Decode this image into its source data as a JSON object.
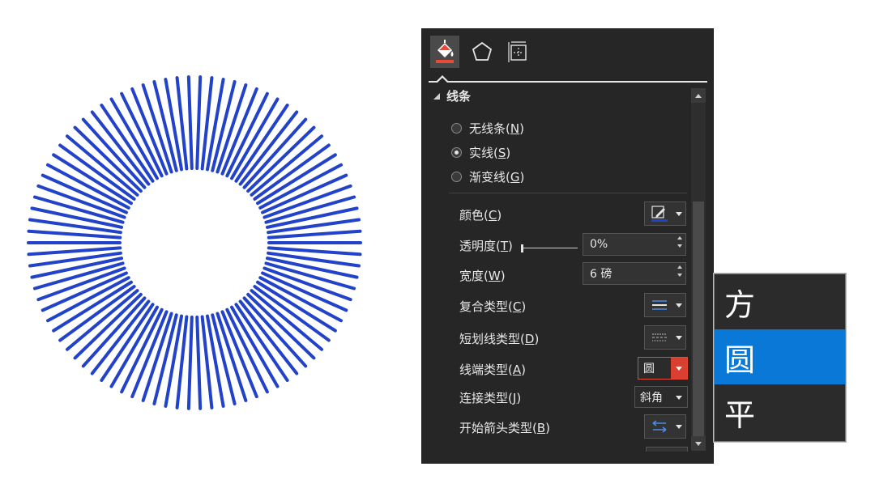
{
  "graphic": {
    "ray_count": 90,
    "color": "#2142c9"
  },
  "pane": {
    "tabs": [
      {
        "icon": "fill-line-icon",
        "active": true
      },
      {
        "icon": "effects-pentagon-icon",
        "active": false
      },
      {
        "icon": "size-properties-icon",
        "active": false
      }
    ],
    "section_title": "线条",
    "radio_options": [
      {
        "label": "无线条",
        "key": "N",
        "checked": false
      },
      {
        "label": "实线",
        "key": "S",
        "checked": true
      },
      {
        "label": "渐变线",
        "key": "G",
        "checked": false
      }
    ],
    "properties": {
      "color_label": "颜色",
      "color_key": "C",
      "transparency_label": "透明度",
      "transparency_key": "T",
      "transparency_value": "0%",
      "width_label": "宽度",
      "width_key": "W",
      "width_value": "6 磅",
      "compound_label": "复合类型",
      "compound_key": "C",
      "dash_label": "短划线类型",
      "dash_key": "D",
      "cap_label": "线端类型",
      "cap_key": "A",
      "cap_value": "圆",
      "join_label": "连接类型",
      "join_key": "J",
      "join_value": "斜角",
      "arrow_start_label": "开始箭头类型",
      "arrow_start_key": "B"
    },
    "accent_color": "#e84a3a",
    "line_color_swatch": "#2142c9"
  },
  "cap_popup": {
    "items": [
      {
        "label": "方",
        "selected": false
      },
      {
        "label": "圆",
        "selected": true
      },
      {
        "label": "平",
        "selected": false
      }
    ],
    "highlight_color": "#0a78d7"
  }
}
